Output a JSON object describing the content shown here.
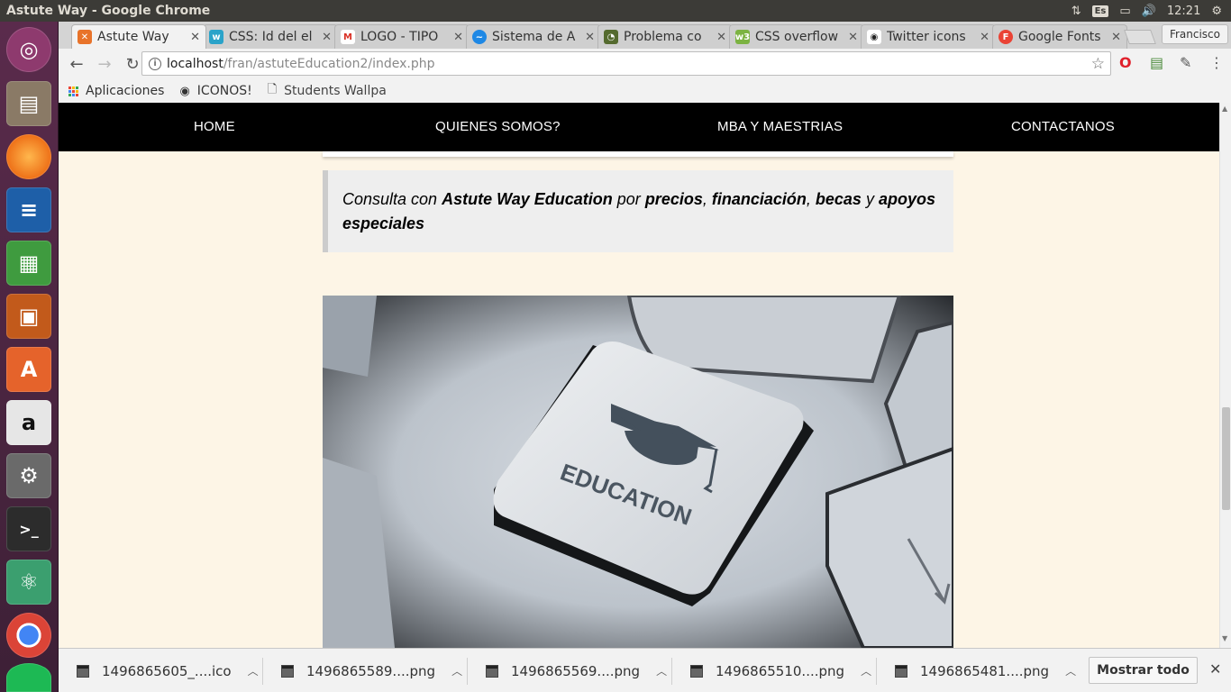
{
  "system": {
    "window_title": "Astute Way - Google Chrome",
    "keyboard_layout": "Es",
    "time": "12:21"
  },
  "browser": {
    "tabs": [
      {
        "label": "Astute Way",
        "color": "#e8732a",
        "icon": "xampp-icon"
      },
      {
        "label": "CSS: Id del el",
        "color": "#2aa3c9",
        "icon": "docs-icon"
      },
      {
        "label": "LOGO - TIPO",
        "color": "#d93025",
        "icon": "gmail-icon"
      },
      {
        "label": "Sistema de A",
        "color": "#1e88e5",
        "icon": "sistema-icon"
      },
      {
        "label": "Problema co",
        "color": "#556b2f",
        "icon": "problema-icon"
      },
      {
        "label": "CSS overflow",
        "color": "#7cb342",
        "icon": "w3-icon"
      },
      {
        "label": "Twitter icons",
        "color": "#222222",
        "icon": "eye-icon"
      },
      {
        "label": "Google Fonts",
        "color": "#ea4335",
        "icon": "google-fonts-icon"
      }
    ],
    "profile": "Francisco",
    "url_host": "localhost",
    "url_path": "/fran/astuteEducation2/index.php",
    "bookmarks": [
      "Aplicaciones",
      "ICONOS!",
      "Students Wallpa"
    ]
  },
  "page": {
    "nav": [
      "HOME",
      "QUIENES SOMOS?",
      "MBA Y MAESTRIAS",
      "CONTACTANOS"
    ],
    "quote": {
      "p1": "Consulta con ",
      "b1": "Astute Way Education",
      "p2": " por ",
      "b2": "precios",
      "p3": ", ",
      "b3": "financiación",
      "p4": ", ",
      "b4": "becas",
      "p5": " y ",
      "b5": "apoyos especiales"
    },
    "image_key_text": "EDUCATION"
  },
  "downloads": {
    "items": [
      "1496865605_....ico",
      "1496865589....png",
      "1496865569....png",
      "1496865510....png",
      "1496865481....png"
    ],
    "show_all": "Mostrar todo"
  }
}
